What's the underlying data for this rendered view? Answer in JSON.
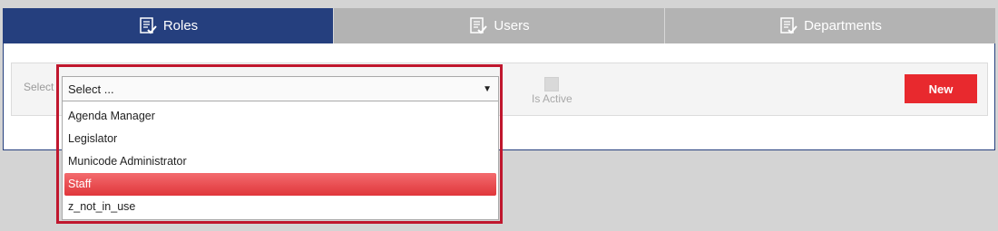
{
  "tabs": [
    {
      "label": "Roles",
      "icon": "checklist-icon",
      "active": true
    },
    {
      "label": "Users",
      "icon": "checklist-icon",
      "active": false
    },
    {
      "label": "Departments",
      "icon": "checklist-icon",
      "active": false
    }
  ],
  "toolbar": {
    "select_label": "Select",
    "select_value": "Select ...",
    "is_active_label": "Is Active",
    "new_button": "New"
  },
  "dropdown": {
    "options": [
      "Agenda Manager",
      "Legislator",
      "Municode Administrator",
      "Staff",
      "z_not_in_use"
    ],
    "highlighted": "Staff"
  },
  "colors": {
    "active_tab": "#253f7e",
    "inactive_tab": "#b3b3b3",
    "new_button": "#e8292e",
    "highlight_border": "#c0172e"
  }
}
